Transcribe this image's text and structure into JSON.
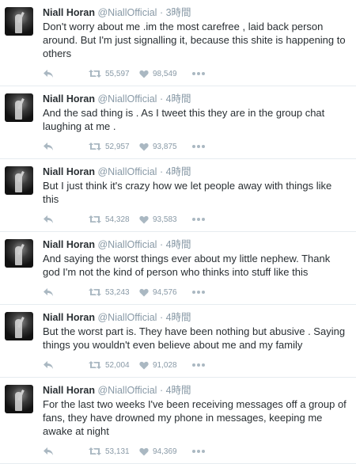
{
  "tweets": [
    {
      "name": "Niall Horan",
      "handle": "@NiallOfficial",
      "time": "3時間",
      "text": "Don't worry about me .im the most carefree , laid back person around. But I'm just signalling it, because this shite is happening to others",
      "retweets": "55,597",
      "likes": "98,549"
    },
    {
      "name": "Niall Horan",
      "handle": "@NiallOfficial",
      "time": "4時間",
      "text": "And the sad thing is . As I tweet this they are in the group chat laughing at me .",
      "retweets": "52,957",
      "likes": "93,875"
    },
    {
      "name": "Niall Horan",
      "handle": "@NiallOfficial",
      "time": "4時間",
      "text": "But I just think it's crazy how we let people away with things like this",
      "retweets": "54,328",
      "likes": "93,583"
    },
    {
      "name": "Niall Horan",
      "handle": "@NiallOfficial",
      "time": "4時間",
      "text": "And saying the worst things ever about my little nephew. Thank god I'm not the kind of person who thinks into stuff like this",
      "retweets": "53,243",
      "likes": "94,576"
    },
    {
      "name": "Niall Horan",
      "handle": "@NiallOfficial",
      "time": "4時間",
      "text": "But the worst part is. They have been nothing but abusive . Saying things you wouldn't even believe about me and my family",
      "retweets": "52,004",
      "likes": "91,028"
    },
    {
      "name": "Niall Horan",
      "handle": "@NiallOfficial",
      "time": "4時間",
      "text": "For the last two weeks I've been receiving messages off a group of fans, they have drowned my phone in messages, keeping me awake at night",
      "retweets": "53,131",
      "likes": "94,369"
    }
  ],
  "separator": "·",
  "icons": {
    "reply": "reply-icon",
    "retweet": "retweet-icon",
    "like": "heart-icon",
    "more": "more-icon"
  },
  "colors": {
    "icon": "#aab8c2",
    "count": "#8899a6",
    "divider": "#e6ecf0"
  }
}
